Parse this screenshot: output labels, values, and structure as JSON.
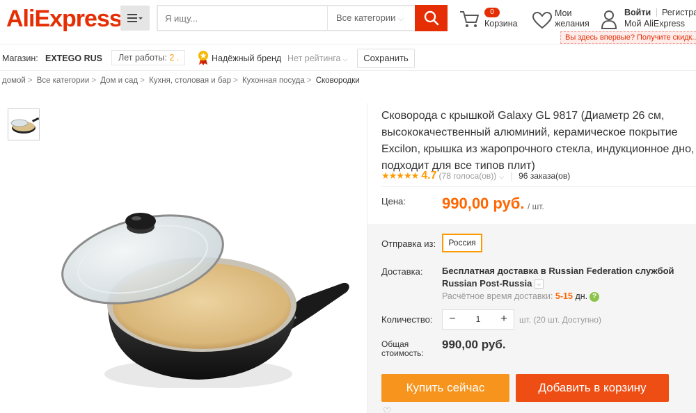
{
  "header": {
    "logo_text": "AliExpress",
    "logo_mark": "®",
    "menu_icon": "hamburger-menu-icon",
    "search_placeholder": "Я ищу...",
    "search_category": "Все категории",
    "search_icon": "search-icon",
    "cart_count": "0",
    "cart_label": "Корзина",
    "wishlist_label_1": "Мои",
    "wishlist_label_2": "желания",
    "login_label": "Войти",
    "register_label": "Регистрация",
    "my_account_label": "Мой AliExpress",
    "first_visit_text": "Вы здесь впервые? Получите скидк..."
  },
  "store_bar": {
    "store_prefix": "Магазин:",
    "store_name": "EXTEGO RUS",
    "years_label": "Лет работы:",
    "years_value": "2 .",
    "brand_label": "Надёжный бренд",
    "rating_label": "Нет рейтинга",
    "save_label": "Сохранить"
  },
  "breadcrumbs": [
    "домой",
    "Все категории",
    "Дом и сад",
    "Кухня, столовая и бар",
    "Кухонная посуда",
    "Сковородки"
  ],
  "product": {
    "title": "Сковорода с крышкой Galaxy GL 9817 (Диаметр 26 см, высококачественный алюминий, керамическое покрытие Excilon, крышка из жаропрочного стекла, индукционное дно, подходит для все типов плит)",
    "stars": "★★★★★",
    "rating": "4.7",
    "votes": "(78 голоса(ов))",
    "orders": "96 заказа(ов)",
    "price_label": "Цена:",
    "price": "990,00 руб.",
    "price_unit": "/ шт.",
    "ship_from_label": "Отправка из:",
    "ship_from_value": "Россия",
    "delivery_label": "Доставка:",
    "delivery_text": "Бесплатная доставка в Russian Federation службой Russian Post-Russia",
    "est_label": "Расчётное время доставки:",
    "est_value": "5-15",
    "est_unit": "дн.",
    "quantity_label": "Количество:",
    "quantity_value": "1",
    "stock_text": "шт. (20 шт. Доступно)",
    "total_label_1": "Общая",
    "total_label_2": "стоимость:",
    "total_value": "990,00 руб.",
    "buy_now_label": "Купить сейчас",
    "add_to_cart_label": "Добавить в корзину"
  },
  "colors": {
    "brand_red": "#e62e04",
    "price_orange": "#ff6600",
    "buy_button": "#f7941d",
    "cart_button": "#ee4e14"
  }
}
